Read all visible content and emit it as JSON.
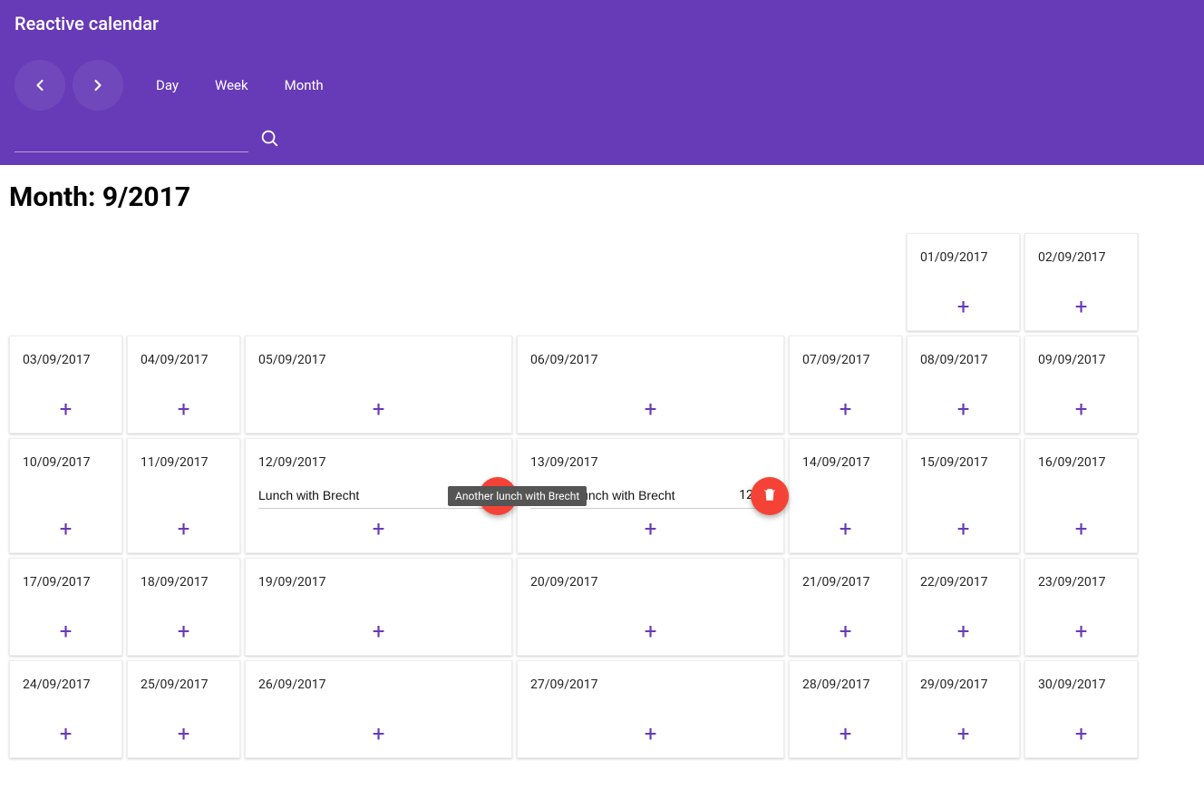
{
  "header": {
    "title": "Reactive calendar",
    "views": {
      "day": "Day",
      "week": "Week",
      "month": "Month"
    },
    "search_value": ""
  },
  "main": {
    "title": "Month: 9/2017"
  },
  "tooltip": "Another lunch with Brecht",
  "grid": {
    "leading_blanks": 5,
    "days": [
      {
        "date": "01/09/2017",
        "events": []
      },
      {
        "date": "02/09/2017",
        "events": []
      },
      {
        "date": "03/09/2017",
        "events": []
      },
      {
        "date": "04/09/2017",
        "events": []
      },
      {
        "date": "05/09/2017",
        "events": []
      },
      {
        "date": "06/09/2017",
        "events": []
      },
      {
        "date": "07/09/2017",
        "events": []
      },
      {
        "date": "08/09/2017",
        "events": []
      },
      {
        "date": "09/09/2017",
        "events": []
      },
      {
        "date": "10/09/2017",
        "events": []
      },
      {
        "date": "11/09/2017",
        "events": []
      },
      {
        "date": "12/09/2017",
        "events": [
          {
            "title": "Lunch with Brecht",
            "time": "12",
            "show_tooltip": true
          }
        ]
      },
      {
        "date": "13/09/2017",
        "events": [
          {
            "title": "Another lunch with Brecht",
            "time": "12:00",
            "show_tooltip": false
          }
        ]
      },
      {
        "date": "14/09/2017",
        "events": []
      },
      {
        "date": "15/09/2017",
        "events": []
      },
      {
        "date": "16/09/2017",
        "events": []
      },
      {
        "date": "17/09/2017",
        "events": []
      },
      {
        "date": "18/09/2017",
        "events": []
      },
      {
        "date": "19/09/2017",
        "events": []
      },
      {
        "date": "20/09/2017",
        "events": []
      },
      {
        "date": "21/09/2017",
        "events": []
      },
      {
        "date": "22/09/2017",
        "events": []
      },
      {
        "date": "23/09/2017",
        "events": []
      },
      {
        "date": "24/09/2017",
        "events": []
      },
      {
        "date": "25/09/2017",
        "events": []
      },
      {
        "date": "26/09/2017",
        "events": []
      },
      {
        "date": "27/09/2017",
        "events": []
      },
      {
        "date": "28/09/2017",
        "events": []
      },
      {
        "date": "29/09/2017",
        "events": []
      },
      {
        "date": "30/09/2017",
        "events": []
      }
    ]
  }
}
